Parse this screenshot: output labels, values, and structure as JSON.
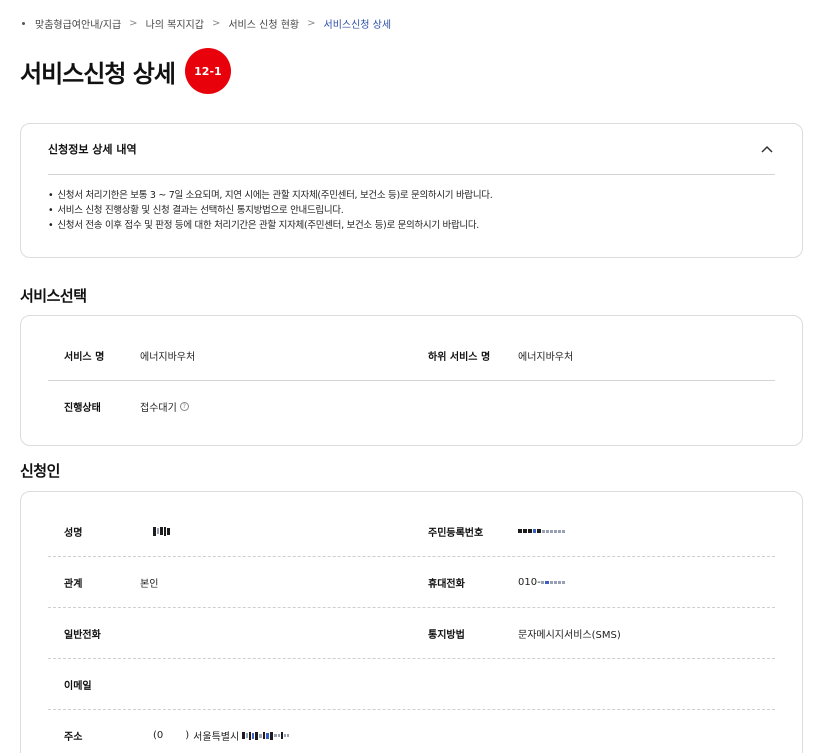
{
  "breadcrumb": [
    "맞춤형급여안내/지급",
    "나의 복지지갑",
    "서비스 신청 현황",
    "서비스신청 상세"
  ],
  "header": {
    "title": "서비스신청 상세",
    "badge": "12-1"
  },
  "info": {
    "title": "신청정보 상세 내역",
    "notes": [
      "신청서 처리기한은 보통 3 ~ 7일 소요되며, 지연 시에는 관할 지자체(주민센터, 보건소 등)로 문의하시기 바랍니다.",
      "서비스 신청 진행상황 및 신청 결과는 선택하신 통지방법으로 안내드립니다.",
      "신청서 전송 이후 접수 및 판정 등에 대한 처리기간은 관할 지자체(주민센터, 보건소 등)로 문의하시기 바랍니다."
    ]
  },
  "service": {
    "section_title": "서비스선택",
    "service_name_label": "서비스 명",
    "service_name": "에너지바우처",
    "sub_service_label": "하위 서비스 명",
    "sub_service": "에너지바우처",
    "status_label": "진행상태",
    "status": "접수대기"
  },
  "applicant": {
    "section_title": "신청인",
    "name_label": "성명",
    "resident_label": "주민등록번호",
    "relation_label": "관계",
    "relation": "본인",
    "mobile_label": "휴대전화",
    "mobile_prefix": "010-",
    "phone_label": "일반전화",
    "notify_label": "통지방법",
    "notify": "문자메시지서비스(SMS)",
    "email_label": "이메일",
    "address_label": "주소",
    "address_zip_open": "(0",
    "address_zip_close": ")",
    "address_city": "서울특별시"
  },
  "icons": {
    "collapse": "chevron-up-icon",
    "help": "question-circle-icon"
  },
  "colors": {
    "badge": "#e8000b",
    "breadcrumb_current": "#2c4ea8"
  }
}
